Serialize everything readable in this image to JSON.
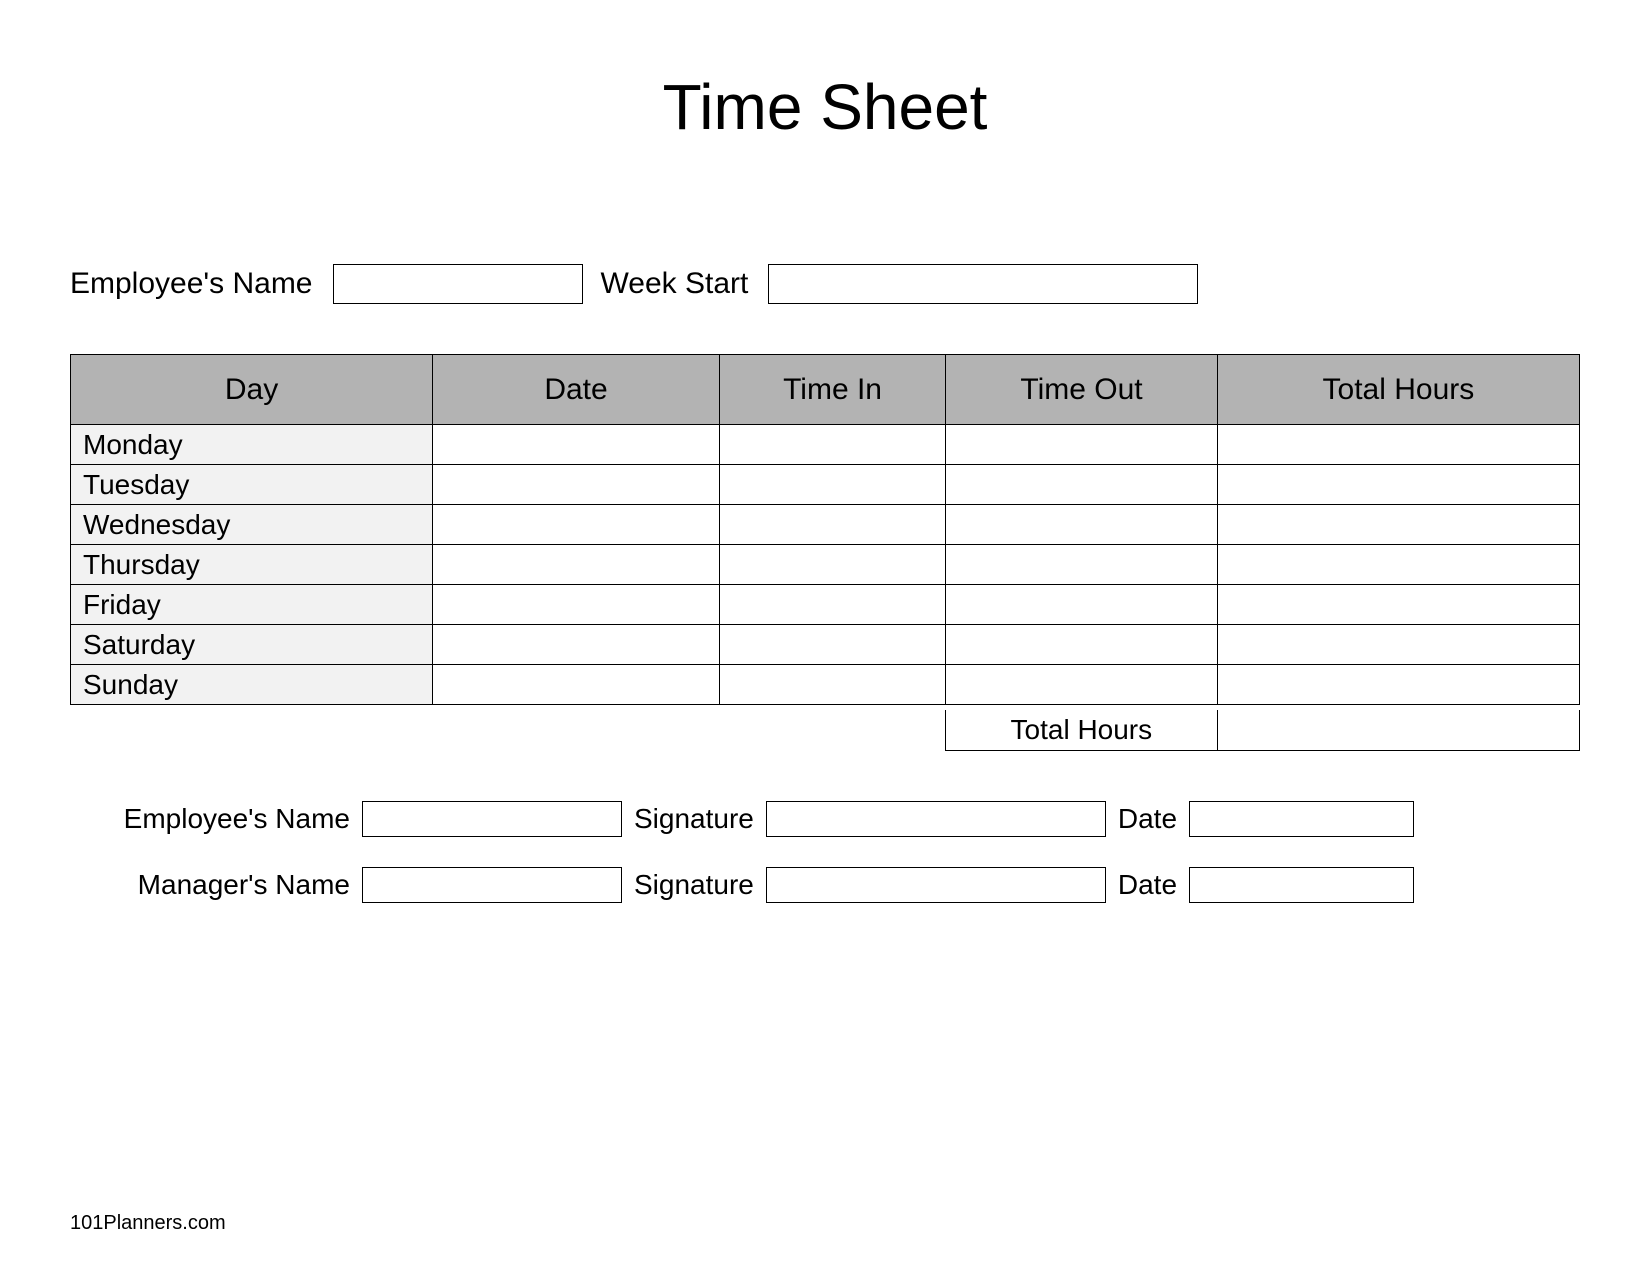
{
  "title": "Time Sheet",
  "header": {
    "employee_name_label": "Employee's Name",
    "week_start_label": "Week Start"
  },
  "table": {
    "columns": [
      "Day",
      "Date",
      "Time In",
      "Time Out",
      "Total Hours"
    ],
    "days": [
      "Monday",
      "Tuesday",
      "Wednesday",
      "Thursday",
      "Friday",
      "Saturday",
      "Sunday"
    ],
    "total_label": "Total Hours"
  },
  "signoff": {
    "employee": {
      "name_label": "Employee's Name",
      "signature_label": "Signature",
      "date_label": "Date"
    },
    "manager": {
      "name_label": "Manager's Name",
      "signature_label": "Signature",
      "date_label": "Date"
    }
  },
  "footer": "101Planners.com"
}
